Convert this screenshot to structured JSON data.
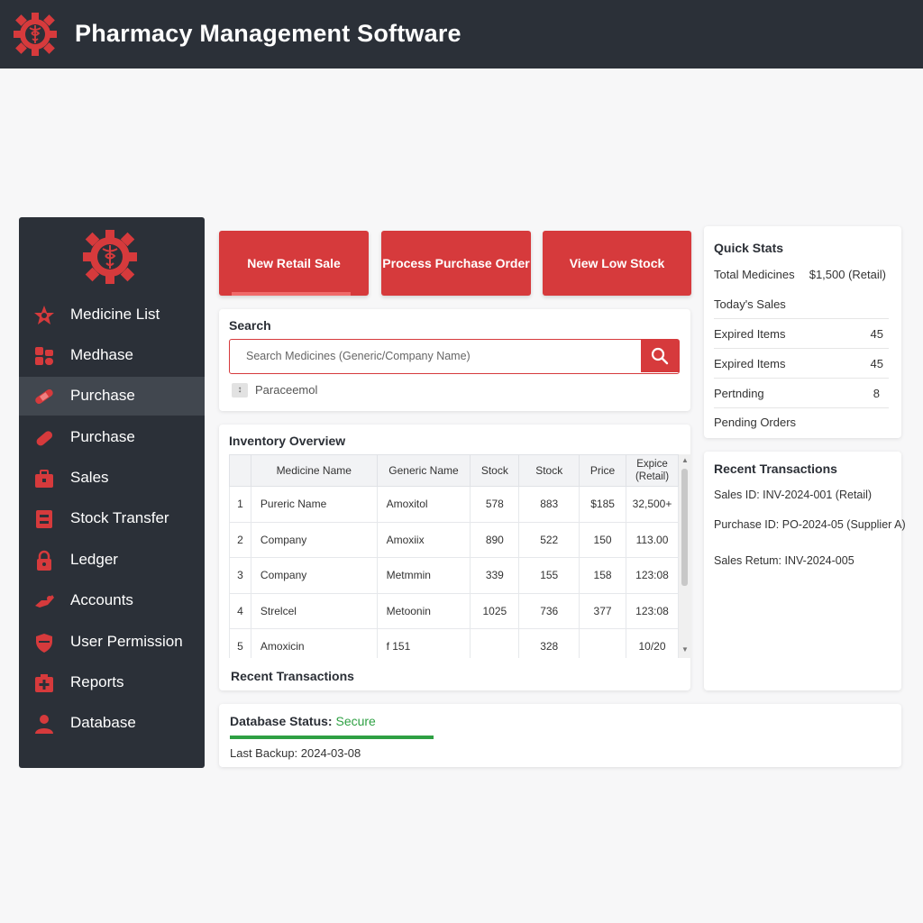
{
  "header": {
    "title": "Pharmacy Management Software",
    "logo_icon": "caduceus-gear-icon"
  },
  "colors": {
    "accent": "#d63a3c",
    "dark": "#2b3038",
    "success": "#2ea043"
  },
  "sidebar": {
    "items": [
      {
        "label": "Medicine List",
        "icon": "star-icon"
      },
      {
        "label": "Medhase",
        "icon": "pills-icon"
      },
      {
        "label": "Purchase",
        "icon": "bandage-icon",
        "active": true
      },
      {
        "label": "Purchase",
        "icon": "capsule-icon"
      },
      {
        "label": "Sales",
        "icon": "briefcase-icon"
      },
      {
        "label": "Stock Transfer",
        "icon": "box-icon"
      },
      {
        "label": "Ledger",
        "icon": "lock-icon"
      },
      {
        "label": "Accounts",
        "icon": "hand-icon"
      },
      {
        "label": "User Permission",
        "icon": "shield-icon"
      },
      {
        "label": "Reports",
        "icon": "first-aid-icon"
      },
      {
        "label": "Database",
        "icon": "user-icon"
      }
    ]
  },
  "actions": {
    "new_retail_sale": "New Retail Sale",
    "process_purchase_order": "Process Purchase Order",
    "view_low_stock": "View Low Stock"
  },
  "search": {
    "title": "Search",
    "placeholder": "Search Medicines (Generic/Company Name)",
    "suggestion": "Paraceemol"
  },
  "inventory": {
    "title": "Inventory Overview",
    "columns": [
      "",
      "Medicine Name",
      "Generic Name",
      "Stock",
      "Stock",
      "Price",
      "Expice (Retail)"
    ],
    "rows": [
      [
        "1",
        "Pureric Name",
        "Amoxitol",
        "578",
        "883",
        "$185",
        "32,500+"
      ],
      [
        "2",
        "Company",
        "Amoxiix",
        "890",
        "522",
        "150",
        "113.00"
      ],
      [
        "3",
        "Company",
        "Metmmin",
        "339",
        "155",
        "158",
        "123:08"
      ],
      [
        "4",
        "Strelcel",
        "Metoonin",
        "1025",
        "736",
        "377",
        "123:08"
      ],
      [
        "5",
        "Amoxicin",
        "f 151",
        "",
        "328",
        "",
        "10/20"
      ]
    ],
    "footer": "Recent Transactions"
  },
  "quick_stats": {
    "title": "Quick Stats",
    "rows": [
      {
        "label": "Total Medicines",
        "value": "$1,500 (Retail)"
      },
      {
        "label": "Today's Sales",
        "value": ""
      },
      {
        "label": "Expired Items",
        "value": "45"
      },
      {
        "label": "Expired Items",
        "value": "45"
      },
      {
        "label": "Pertnding",
        "value": "8"
      },
      {
        "label": "Pending Orders",
        "value": ""
      }
    ]
  },
  "recent_transactions": {
    "title": "Recent Transactions",
    "items": [
      "Sales ID: INV-2024-001 (Retail)",
      "Purchase ID: PO-2024-05 (Supplier A)",
      "Sales Retum: INV-2024-005"
    ]
  },
  "database_status": {
    "label": "Database Status:",
    "value": "Secure",
    "last_backup": "Last Backup: 2024-03-08"
  }
}
